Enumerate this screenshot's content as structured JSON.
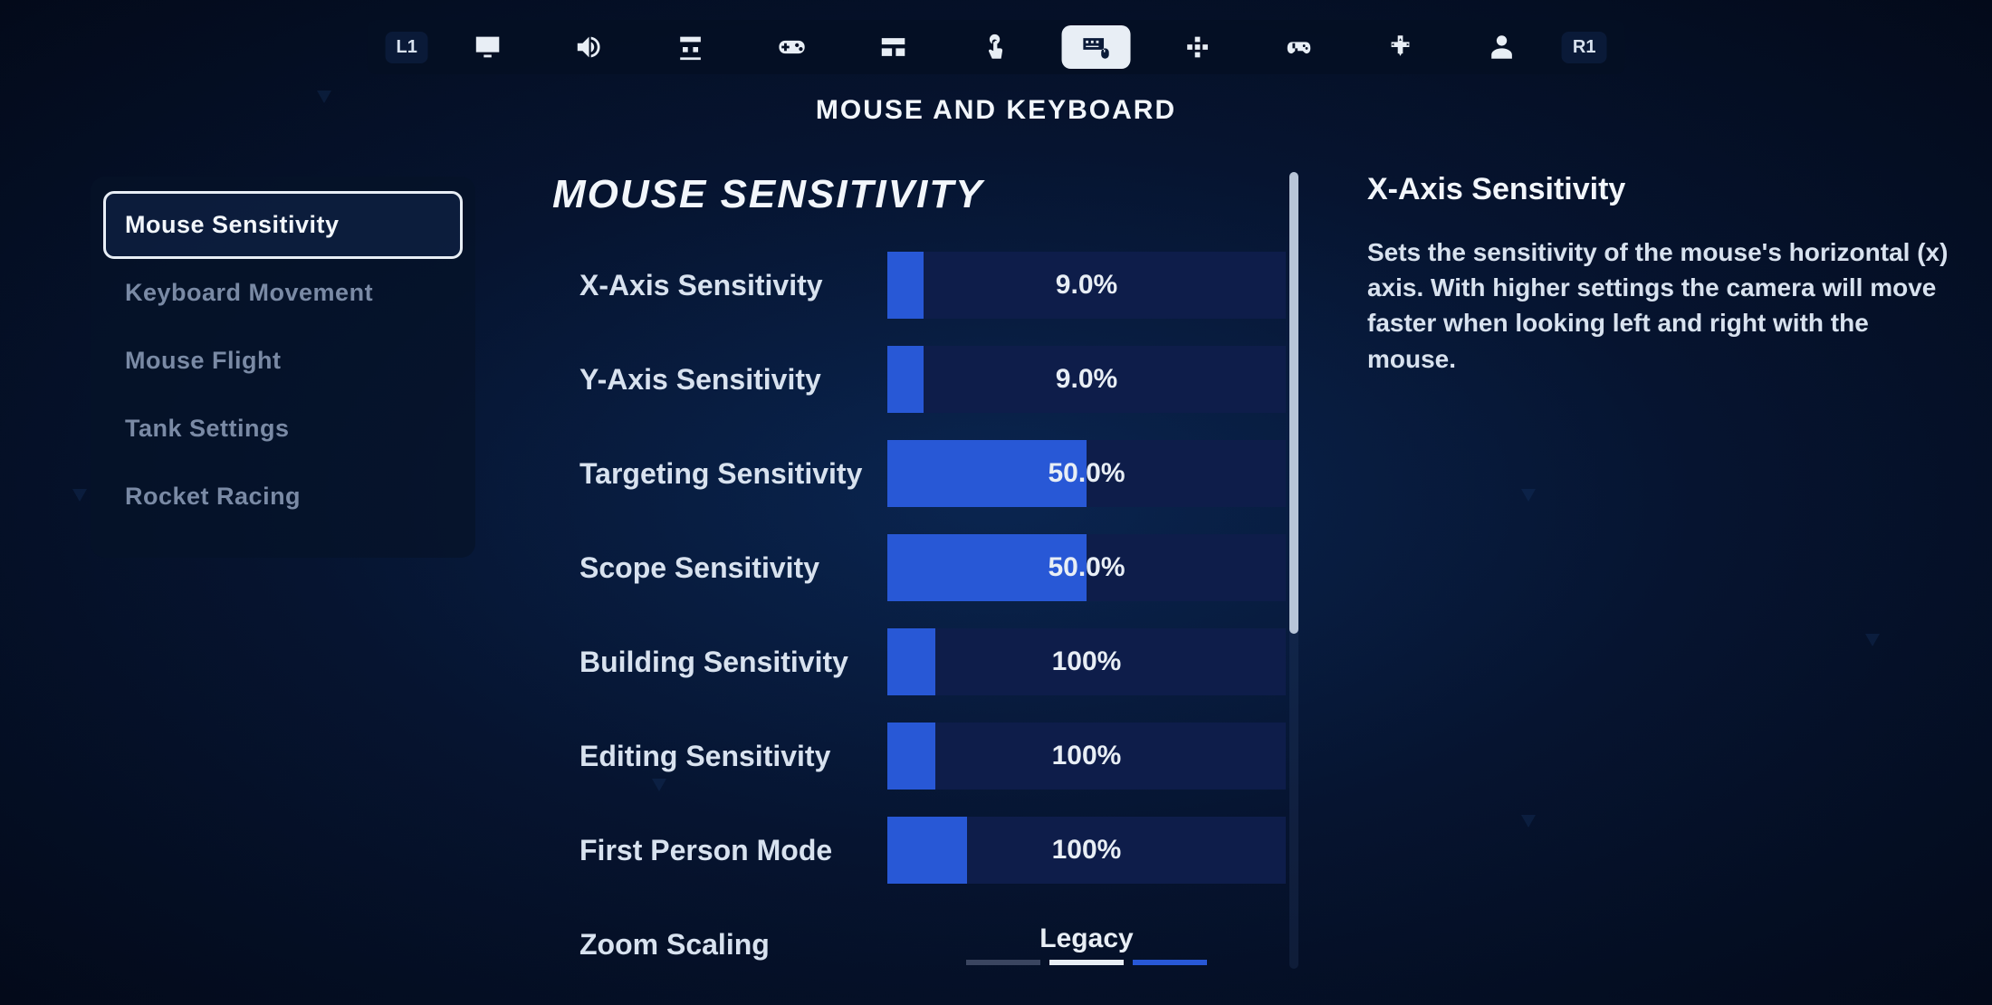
{
  "header": {
    "bumper_left": "L1",
    "bumper_right": "R1",
    "title": "MOUSE AND KEYBOARD",
    "tabs": [
      {
        "name": "video"
      },
      {
        "name": "audio"
      },
      {
        "name": "game"
      },
      {
        "name": "controller"
      },
      {
        "name": "hud"
      },
      {
        "name": "touch"
      },
      {
        "name": "mouse-keyboard",
        "active": true
      },
      {
        "name": "accessibility"
      },
      {
        "name": "wireless-controller"
      },
      {
        "name": "gamepad-alt"
      },
      {
        "name": "account"
      }
    ]
  },
  "sidebar": {
    "items": [
      {
        "label": "Mouse Sensitivity",
        "selected": true
      },
      {
        "label": "Keyboard Movement"
      },
      {
        "label": "Mouse Flight"
      },
      {
        "label": "Tank Settings"
      },
      {
        "label": "Rocket Racing"
      }
    ]
  },
  "section": {
    "title": "MOUSE SENSITIVITY",
    "settings": [
      {
        "label": "X-Axis Sensitivity",
        "value": "9.0%",
        "fill": 9
      },
      {
        "label": "Y-Axis Sensitivity",
        "value": "9.0%",
        "fill": 9
      },
      {
        "label": "Targeting Sensitivity",
        "value": "50.0%",
        "fill": 50
      },
      {
        "label": "Scope Sensitivity",
        "value": "50.0%",
        "fill": 50
      },
      {
        "label": "Building Sensitivity",
        "value": "100%",
        "fill": 12
      },
      {
        "label": "Editing Sensitivity",
        "value": "100%",
        "fill": 12
      },
      {
        "label": "First Person Mode",
        "value": "100%",
        "fill": 20
      }
    ],
    "option": {
      "label": "Zoom Scaling",
      "value": "Legacy"
    }
  },
  "help": {
    "title": "X-Axis Sensitivity",
    "text": "Sets the sensitivity of the mouse's horizontal (x) axis. With higher settings the camera will move faster when looking left and right with the mouse."
  }
}
